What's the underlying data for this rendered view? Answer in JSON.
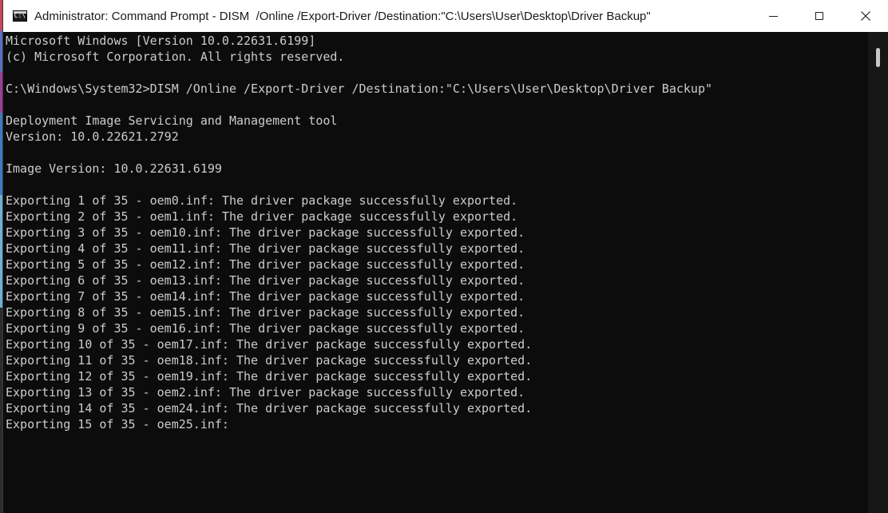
{
  "window": {
    "title": "Administrator: Command Prompt - DISM  /Online /Export-Driver /Destination:\"C:\\Users\\User\\Desktop\\Driver Backup\"",
    "app_icon": "command-prompt-icon",
    "app_icon_text": "C:\\",
    "controls": {
      "minimize_icon": "minimize-icon",
      "maximize_icon": "maximize-icon",
      "close_icon": "close-icon"
    }
  },
  "console": {
    "lines": [
      "Microsoft Windows [Version 10.0.22631.6199]",
      "(c) Microsoft Corporation. All rights reserved.",
      "",
      "C:\\Windows\\System32>DISM /Online /Export-Driver /Destination:\"C:\\Users\\User\\Desktop\\Driver Backup\"",
      "",
      "Deployment Image Servicing and Management tool",
      "Version: 10.0.22621.2792",
      "",
      "Image Version: 10.0.22631.6199",
      "",
      "Exporting 1 of 35 - oem0.inf: The driver package successfully exported.",
      "Exporting 2 of 35 - oem1.inf: The driver package successfully exported.",
      "Exporting 3 of 35 - oem10.inf: The driver package successfully exported.",
      "Exporting 4 of 35 - oem11.inf: The driver package successfully exported.",
      "Exporting 5 of 35 - oem12.inf: The driver package successfully exported.",
      "Exporting 6 of 35 - oem13.inf: The driver package successfully exported.",
      "Exporting 7 of 35 - oem14.inf: The driver package successfully exported.",
      "Exporting 8 of 35 - oem15.inf: The driver package successfully exported.",
      "Exporting 9 of 35 - oem16.inf: The driver package successfully exported.",
      "Exporting 10 of 35 - oem17.inf: The driver package successfully exported.",
      "Exporting 11 of 35 - oem18.inf: The driver package successfully exported.",
      "Exporting 12 of 35 - oem19.inf: The driver package successfully exported.",
      "Exporting 13 of 35 - oem2.inf: The driver package successfully exported.",
      "Exporting 14 of 35 - oem24.inf: The driver package successfully exported.",
      "Exporting 15 of 35 - oem25.inf:"
    ]
  },
  "colors": {
    "console_background": "#0c0c0c",
    "console_text": "#cccccc",
    "titlebar_background": "#ffffff"
  }
}
